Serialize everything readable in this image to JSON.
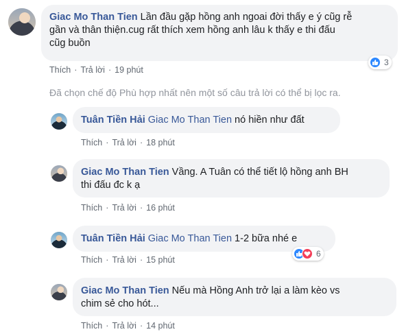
{
  "comments": [
    {
      "author": "Giac Mo Than Tien",
      "tag": "",
      "text_line1": "Lần đầu gặp hồng anh ngoai đời thấy e ý cũg rễ",
      "text_line2": "gần và thân thiện.cug rất thích xem hồng anh lâu k thấy e thi đấu",
      "text_line3": "cũg buồn",
      "like_label": "Thích",
      "reply_label": "Trả lời",
      "time": "19 phút",
      "reaction_count": "3"
    }
  ],
  "notice": "Đã chọn chế độ Phù hợp nhất nên một số câu trả lời có thể bị lọc ra.",
  "replies": [
    {
      "author": "Tuân Tiền Hải",
      "tag": "Giac Mo Than Tien",
      "text": "nó hiền như đất",
      "like_label": "Thích",
      "reply_label": "Trả lời",
      "time": "18 phút"
    },
    {
      "author": "Giac Mo Than Tien",
      "text_line1": "Vầng. A Tuân có thể tiết lộ hồng anh BH",
      "text_line2": "thi đấu đc k ạ",
      "like_label": "Thích",
      "reply_label": "Trả lời",
      "time": "16 phút"
    },
    {
      "author": "Tuân Tiền Hải",
      "tag": "Giac Mo Than Tien",
      "text": "1-2 bữa nhé e",
      "like_label": "Thích",
      "reply_label": "Trả lời",
      "time": "15 phút",
      "reaction_count": "6"
    },
    {
      "author": "Giac Mo Than Tien",
      "text_line1": "Nếu mà Hồng Anh trở lại a làm kèo vs",
      "text_line2": "chim sẻ cho hót...",
      "like_label": "Thích",
      "reply_label": "Trả lời",
      "time": "14 phút"
    }
  ],
  "colors": {
    "author": "#385898",
    "bubble": "#f2f3f5",
    "meta": "#606770",
    "notice": "#90949c",
    "like": "#2d88ff",
    "love": "#f33e58"
  }
}
